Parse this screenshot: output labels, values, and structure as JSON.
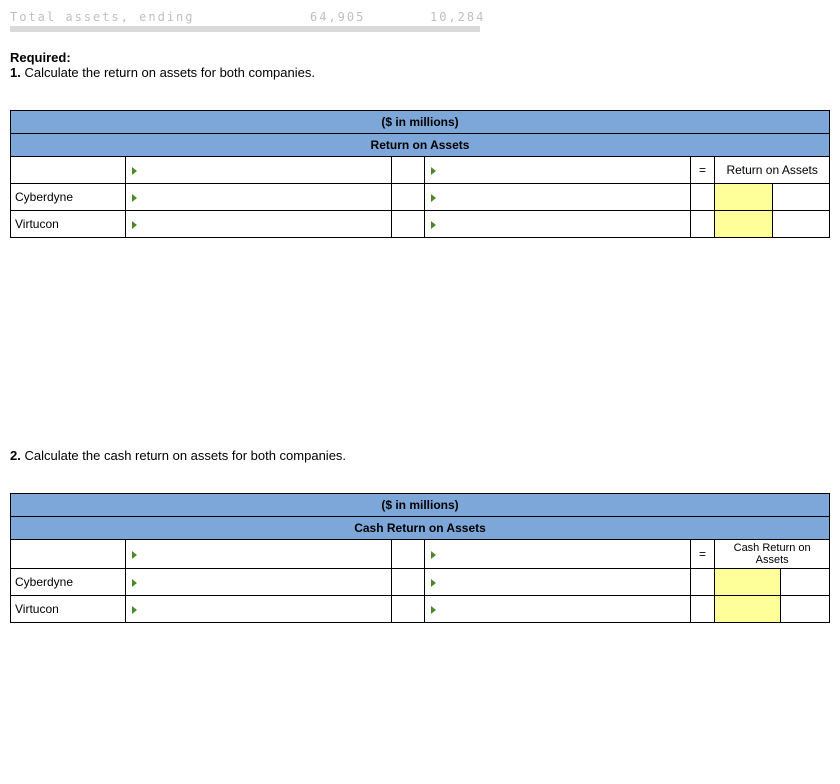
{
  "topfrag": {
    "label": "Total assets, ending",
    "val1": "64,905",
    "val2": "10,284"
  },
  "required": {
    "heading": "Required:",
    "q1": "1.",
    "q1text": "Calculate the return on assets for both companies.",
    "q2": "2.",
    "q2text": "Calculate the cash return on assets for both companies."
  },
  "table1": {
    "unitHeader": "($ in millions)",
    "titleHeader": "Return on Assets",
    "eq": "=",
    "resultLabel": "Return on Assets",
    "rows": [
      "Cyberdyne",
      "Virtucon"
    ]
  },
  "table2": {
    "unitHeader": "($ in millions)",
    "titleHeader": "Cash Return on Assets",
    "eq": "=",
    "resultLabel": "Cash Return on Assets",
    "rows": [
      "Cyberdyne",
      "Virtucon"
    ]
  }
}
